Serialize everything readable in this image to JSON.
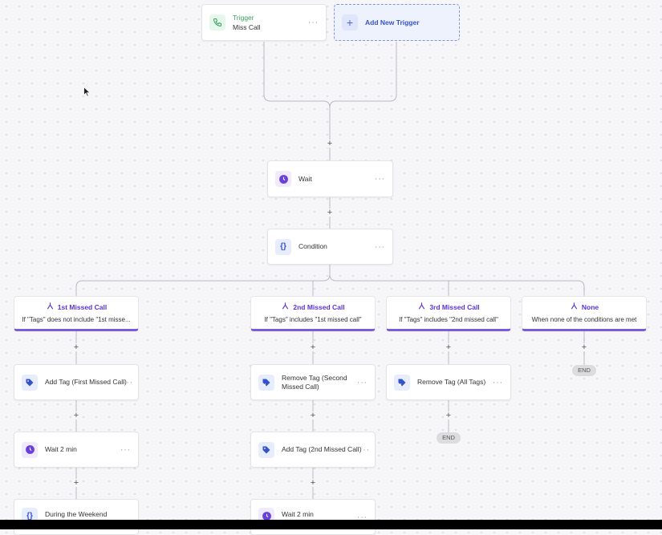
{
  "trigger": {
    "title": "Trigger",
    "subtitle": "Miss Call"
  },
  "add_trigger": {
    "label": "Add New Trigger"
  },
  "main_steps": [
    {
      "label": "Wait",
      "icon": "clock-icon"
    },
    {
      "label": "Condition",
      "icon": "braces-icon"
    }
  ],
  "branches": [
    {
      "title": "1st Missed Call",
      "desc": "If \"Tags\" does not include \"1st misse..."
    },
    {
      "title": "2nd Missed Call",
      "desc": "If \"Tags\" includes \"1st missed call\""
    },
    {
      "title": "3rd Missed Call",
      "desc": "If \"Tags\" includes \"2nd missed call\""
    },
    {
      "title": "None",
      "desc": "When none of the conditions are met"
    }
  ],
  "branch1_steps": [
    {
      "label": "Add Tag (First Missed Call)",
      "icon": "tag-icon"
    },
    {
      "label": "Wait 2 min",
      "icon": "clock-icon"
    },
    {
      "label": "During the Weekend",
      "icon": "braces-icon"
    }
  ],
  "branch2_steps": [
    {
      "label": "Remove Tag (Second Missed Call)",
      "icon": "remove-tag-icon"
    },
    {
      "label": "Add Tag (2nd Missed Call)",
      "icon": "tag-icon"
    },
    {
      "label": "Wait 2 min",
      "icon": "clock-icon"
    }
  ],
  "branch3_steps": [
    {
      "label": "Remove Tag (All Tags)",
      "icon": "remove-tag-icon"
    }
  ],
  "end_label": "END",
  "menu_glyph": "···",
  "plus_glyph": "+",
  "colors": {
    "accent_purple": "#7b5be0",
    "trigger_green": "#3a9c5c",
    "link_blue": "#3552c9"
  }
}
